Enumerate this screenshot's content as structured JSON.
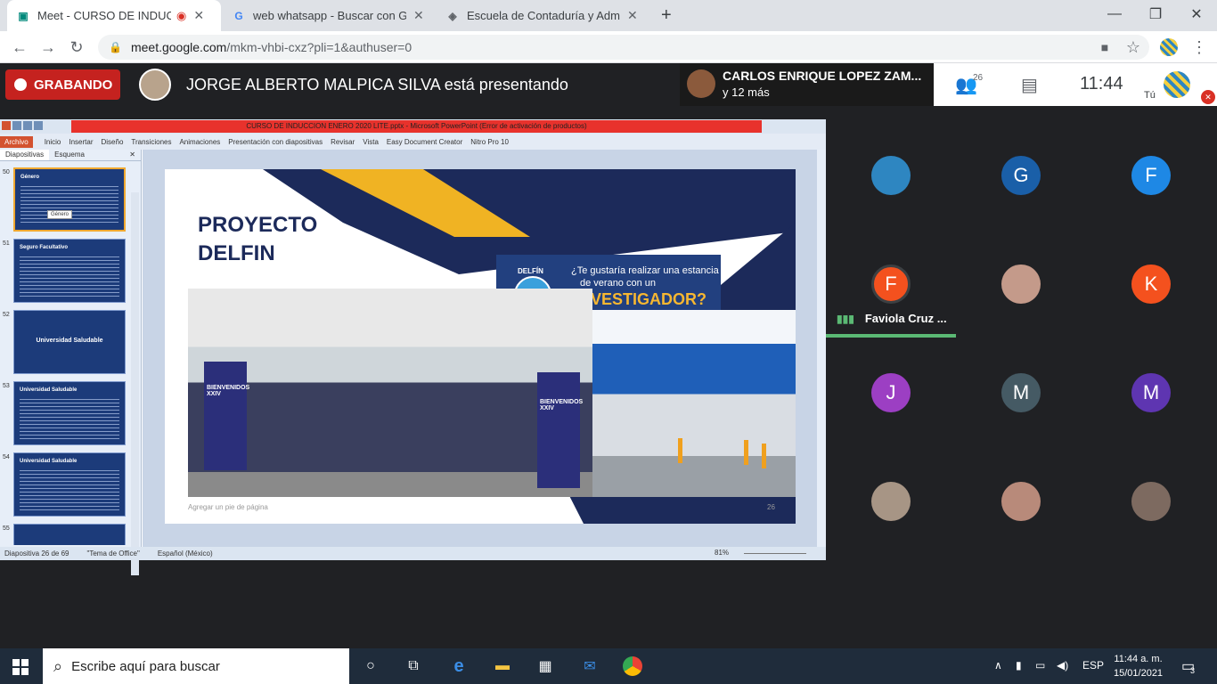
{
  "browser": {
    "tabs": [
      {
        "title": "Meet - CURSO DE INDUCCIÓ",
        "favicon": "meet-icon"
      },
      {
        "title": "web whatsapp - Buscar con Goo",
        "favicon": "google-icon"
      },
      {
        "title": "Escuela de Contaduría y Adminis",
        "favicon": "shield-icon"
      }
    ],
    "url_host": "meet.google.com",
    "url_path": "/mkm-vhbi-cxz?pli=1&authuser=0"
  },
  "meet": {
    "recording_label": "GRABANDO",
    "presenter_text": "JORGE ALBERTO MALPICA SILVA está presentando",
    "active_speaker_name": "CARLOS ENRIQUE LOPEZ ZAM...",
    "active_speaker_more": "y 12 más",
    "people_count": "26",
    "time": "11:44",
    "self_label": "Tú",
    "speaking_name": "Faviola Cruz ...",
    "participants": [
      {
        "initial": "",
        "color": "#2e86c1"
      },
      {
        "initial": "G",
        "color": "#1a5fa8"
      },
      {
        "initial": "F",
        "color": "#1e88e5"
      },
      {
        "initial": "F",
        "color": "#f4511e"
      },
      {
        "initial": "",
        "color": "#c49a8a"
      },
      {
        "initial": "K",
        "color": "#f4511e"
      },
      {
        "initial": "J",
        "color": "#9c3fc3"
      },
      {
        "initial": "M",
        "color": "#455a64"
      },
      {
        "initial": "M",
        "color": "#5e35b1"
      },
      {
        "initial": "",
        "color": "#a79585"
      },
      {
        "initial": "",
        "color": "#b88a7a"
      },
      {
        "initial": "",
        "color": "#7d6a60"
      }
    ]
  },
  "powerpoint": {
    "window_title": "CURSO DE INDUCCION ENERO 2020 LITE.pptx - Microsoft PowerPoint (Error de activación de productos)",
    "menu": [
      "Archivo",
      "Inicio",
      "Insertar",
      "Diseño",
      "Transiciones",
      "Animaciones",
      "Presentación con diapositivas",
      "Revisar",
      "Vista",
      "Easy Document Creator",
      "Nitro Pro 10"
    ],
    "panel_tabs": [
      "Diapositivas",
      "Esquema"
    ],
    "thumbnails": [
      {
        "num": "50",
        "title": "Género",
        "tooltip": "Género"
      },
      {
        "num": "51",
        "title": "Seguro Facultativo"
      },
      {
        "num": "52",
        "title": "Universidad Saludable"
      },
      {
        "num": "53",
        "title": "Universidad Saludable"
      },
      {
        "num": "54",
        "title": "Universidad Saludable"
      },
      {
        "num": "55",
        "title": ""
      }
    ],
    "slide": {
      "title": "PROYECTO\nDELFIN",
      "banner_brand": "DELFÍN",
      "banner_q1": "¿Te gustaría realizar una estancia",
      "banner_q2": "de verano con un",
      "banner_big": "INVESTIGADOR?",
      "stand_text": "BIENVENIDOS XXIV",
      "footer": "Agregar un pie de página",
      "page": "26"
    },
    "status": {
      "slide_of": "Diapositiva 26 de 69",
      "theme": "\"Tema de Office\"",
      "language": "Español (México)",
      "zoom": "81%"
    }
  },
  "taskbar": {
    "search_placeholder": "Escribe aquí para buscar",
    "lang": "ESP",
    "time": "11:44 a. m.",
    "date": "15/01/2021",
    "notif_count": "3"
  }
}
